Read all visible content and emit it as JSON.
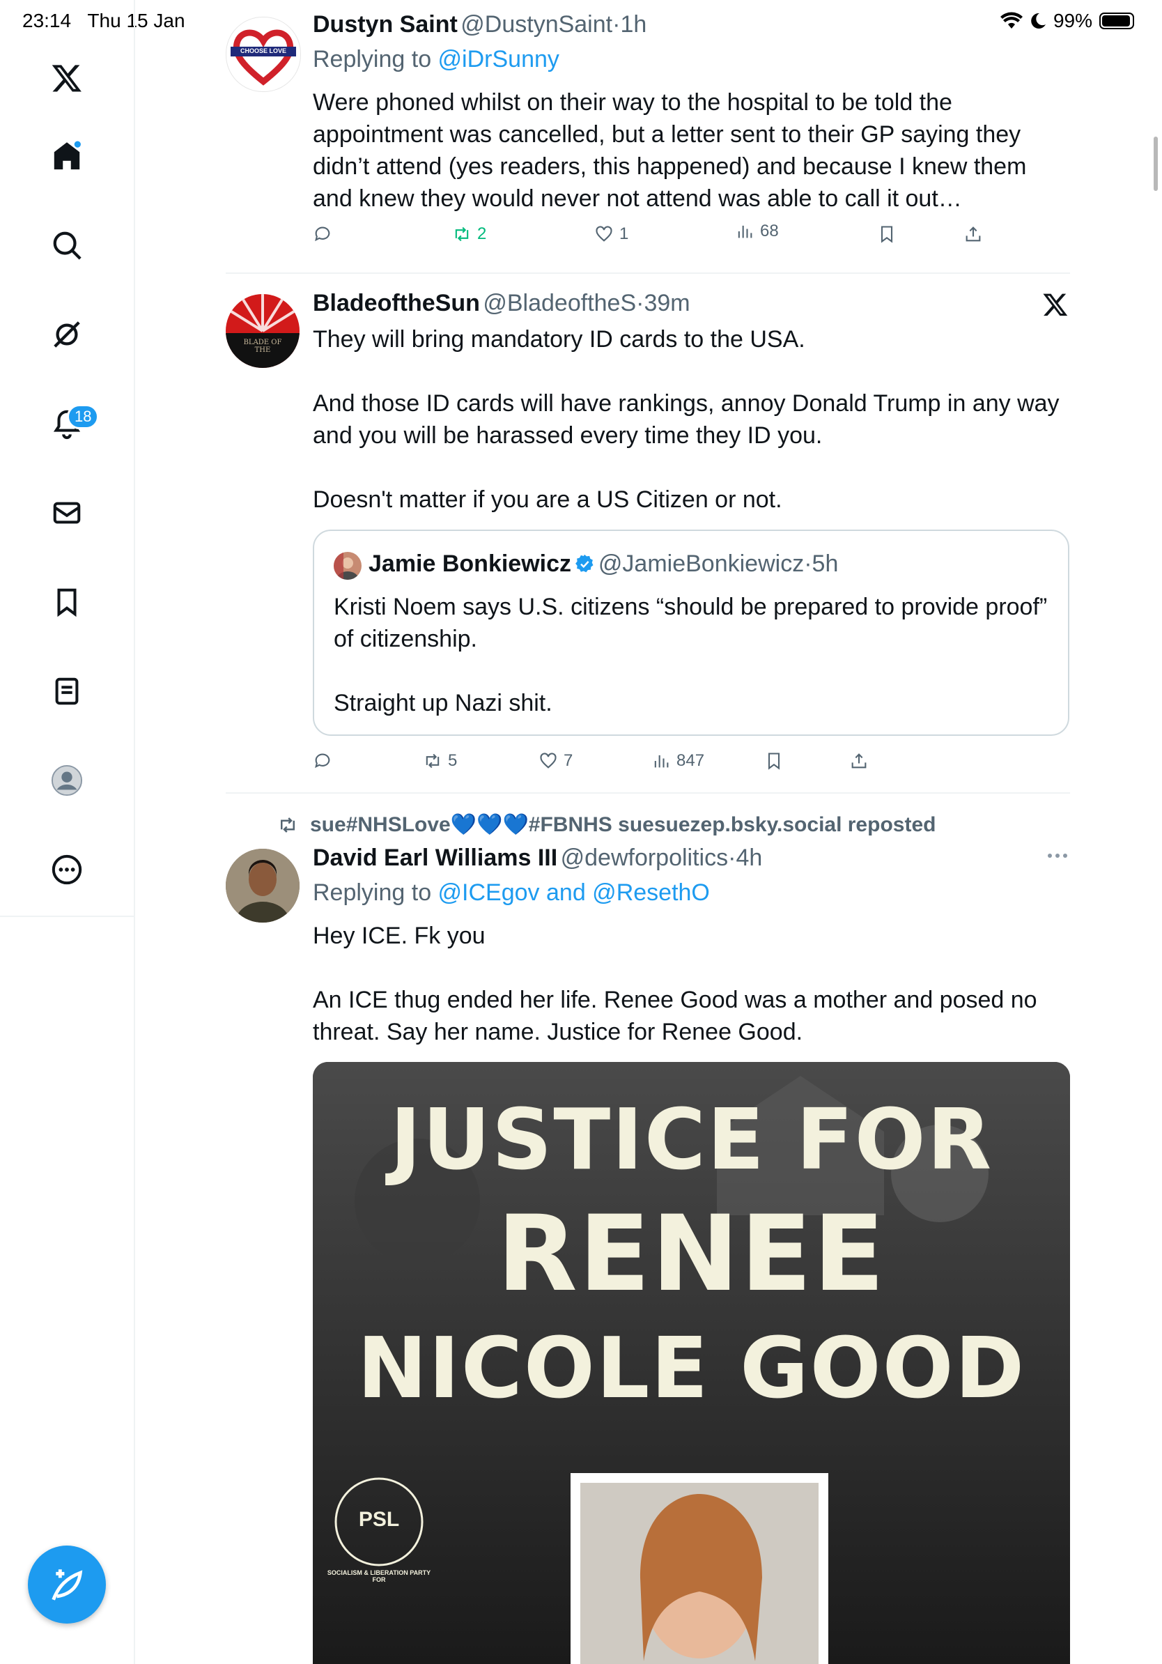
{
  "status_bar": {
    "time": "23:14",
    "date": "Thu 15 Jan",
    "battery": "99%"
  },
  "sidebar": {
    "notifications_badge": "18"
  },
  "tweets": [
    {
      "name": "Dustyn Saint",
      "handle": "@DustynSaint",
      "time": "1h",
      "replying_prefix": "Replying to ",
      "replying_to": "@iDrSunny",
      "avatar_text": "CHOOSE LOVE",
      "text": "Were phoned whilst on their way to the hospital to be told the appointment was cancelled, but a letter sent to their GP saying they didn’t attend (yes readers, this happened) and because I knew them and knew they would never not attend was able to call it out…",
      "retweets": "2",
      "likes": "1",
      "views": "68"
    },
    {
      "name": "BladeoftheSun",
      "handle": "@BladeoftheS",
      "time": "39m",
      "avatar_text": "BLADE OF THE",
      "text": "They will bring mandatory ID cards to the USA.\n\nAnd those ID cards will have rankings, annoy Donald Trump in any way and you will be harassed every time they ID you.\n\nDoesn't matter if you are a US Citizen or not.",
      "quote": {
        "name": "Jamie Bonkiewicz",
        "handle": "@JamieBonkiewicz",
        "time": "5h",
        "text": "Kristi Noem says U.S. citizens “should be prepared to provide proof” of citizenship.\n\nStraight up Nazi shit."
      },
      "retweets": "5",
      "likes": "7",
      "views": "847"
    },
    {
      "repost_by": "sue#NHSLove💙💙💙#FBNHS suesuezep.bsky.social reposted",
      "name": "David Earl Williams III",
      "handle": "@dewforpolitics",
      "time": "4h",
      "replying_prefix": "Replying to ",
      "replying_to": "@ICEgov and @ResethO",
      "text": "Hey ICE. Fk you\n\nAn ICE thug ended her life. Renee Good was a mother and posed no threat. Say her name. Justice for Renee Good.",
      "image": {
        "line1": "JUSTICE FOR",
        "line2": "RENEE",
        "line3": "NICOLE GOOD",
        "logo": "PSL",
        "logo_ring": "SOCIALISM & LIBERATION PARTY FOR"
      }
    }
  ],
  "colors": {
    "accent": "#1d9bf0",
    "secondary_text": "#536471",
    "retweet_green": "#00ba7c",
    "divider": "#eff3f4"
  }
}
